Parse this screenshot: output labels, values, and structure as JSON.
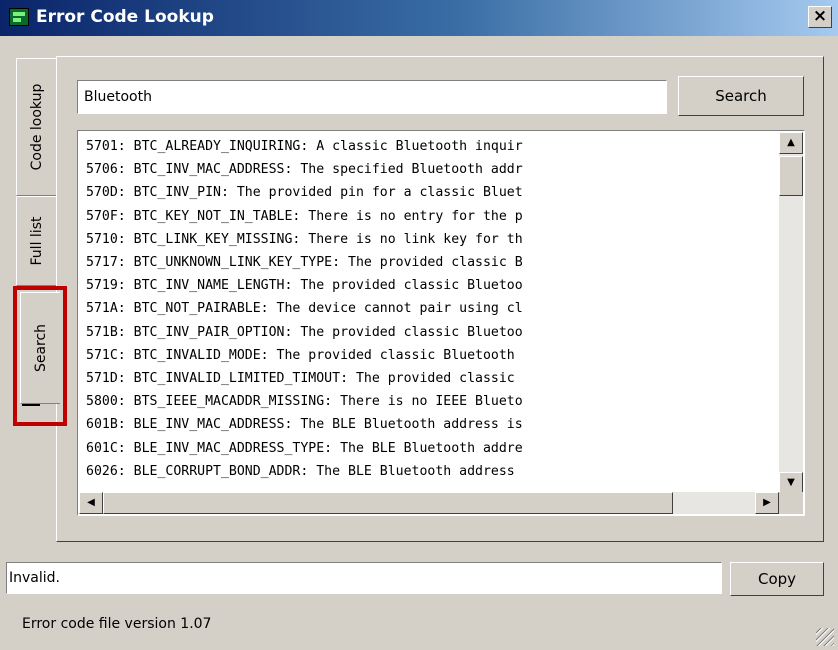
{
  "window": {
    "title": "Error Code Lookup",
    "close_glyph": "×"
  },
  "tabs": [
    {
      "label": "Code lookup",
      "active": false
    },
    {
      "label": "Full list",
      "active": false
    },
    {
      "label": "Search",
      "active": true
    }
  ],
  "search": {
    "value": "Bluetooth",
    "button_label": "Search"
  },
  "results": [
    "5701: BTC_ALREADY_INQUIRING: A classic Bluetooth inquir",
    "5706: BTC_INV_MAC_ADDRESS: The specified Bluetooth addr",
    "570D: BTC_INV_PIN: The provided pin for a classic Bluet",
    "570F: BTC_KEY_NOT_IN_TABLE: There is no entry for the p",
    "5710: BTC_LINK_KEY_MISSING: There is no link key for th",
    "5717: BTC_UNKNOWN_LINK_KEY_TYPE: The provided classic B",
    "5719: BTC_INV_NAME_LENGTH: The provided classic Bluetoo",
    "571A: BTC_NOT_PAIRABLE: The device cannot pair using cl",
    "571B: BTC_INV_PAIR_OPTION: The provided classic Bluetoo",
    "571C: BTC_INVALID_MODE: The provided classic Bluetooth",
    "571D: BTC_INVALID_LIMITED_TIMOUT: The provided classic",
    "5800: BTS_IEEE_MACADDR_MISSING: There is no IEEE Blueto",
    "601B: BLE_INV_MAC_ADDRESS: The BLE Bluetooth address is",
    "601C: BLE_INV_MAC_ADDRESS_TYPE: The BLE Bluetooth addre",
    "6026: BLE_CORRUPT_BOND_ADDR: The BLE Bluetooth address"
  ],
  "scroll": {
    "up": "▲",
    "down": "▼",
    "left": "◀",
    "right": "▶"
  },
  "status": {
    "value": "Invalid.",
    "copy_label": "Copy"
  },
  "footer": {
    "text": "Error code file version 1.07"
  },
  "colors": {
    "highlight": "#c00000",
    "titlebar": "#0a246a"
  }
}
